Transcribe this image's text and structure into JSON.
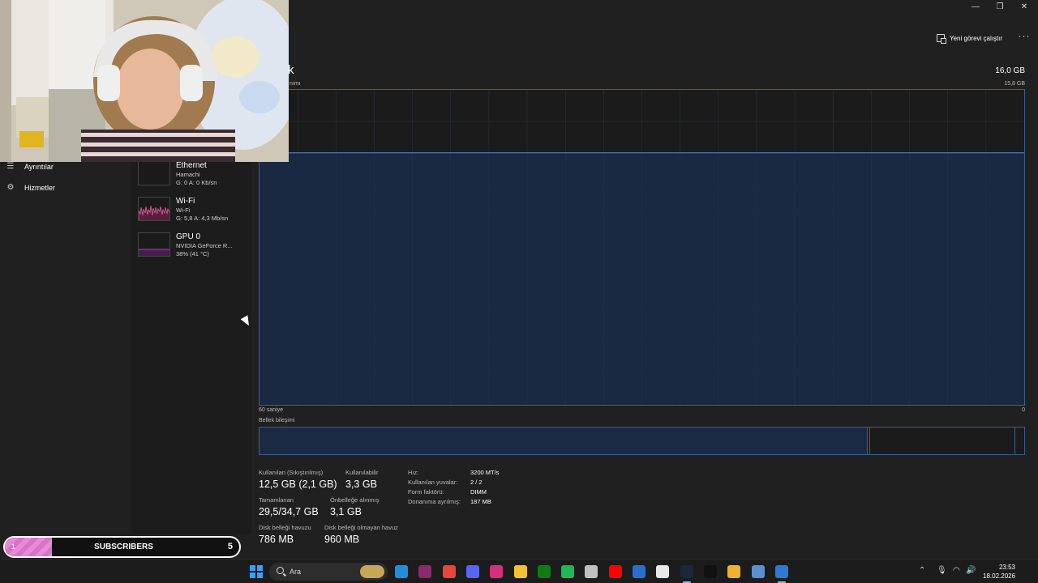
{
  "window": {
    "minimize": "—",
    "maximize": "❐",
    "close": "✕"
  },
  "command_bar": {
    "run_new_task": "Yeni görevi çalıştır",
    "more": "···"
  },
  "nav": {
    "items": [
      {
        "label": "Ayrıntılar",
        "icon": "list-icon"
      },
      {
        "label": "Hizmetler",
        "icon": "puzzle-icon"
      }
    ]
  },
  "devices": [
    {
      "name": "Ethernet",
      "sub": "Hamachi",
      "value": "G: 0 A: 0 Kb/sn",
      "color": "#9c9c9c"
    },
    {
      "name": "Wi-Fi",
      "sub": "Wi-Fi",
      "value": "G: 5,8 A: 4,3 Mb/sn",
      "color": "#e060a0"
    },
    {
      "name": "GPU 0",
      "sub": "NVIDIA GeForce R...",
      "value": "38% (41 °C)",
      "color": "#b040c0"
    }
  ],
  "memory": {
    "title": "k",
    "total": "16,0 GB",
    "usage_label": "nımı",
    "usage_max": "15,8 GB",
    "axis_left": "60 saniye",
    "axis_right": "0",
    "usage_fraction": 0.8,
    "composition_label": "Bellek bileşimi",
    "composition": {
      "in_use_fraction": 0.795,
      "modified_fraction": 0.003,
      "standby_fraction": 0.19
    },
    "stats": {
      "in_use_label": "Kullanılan (Sıkıştırılmış)",
      "in_use_value": "12,5 GB (2,1 GB)",
      "available_label": "Kullanılabilir",
      "available_value": "3,3 GB",
      "committed_label": "Tamamlanan",
      "committed_value": "29,5/34,7 GB",
      "cached_label": "Önbelleğe alınmış",
      "cached_value": "3,1 GB",
      "paged_label": "Disk belleği havuzu",
      "paged_value": "786 MB",
      "nonpaged_label": "Disk belleği olmayan havuz",
      "nonpaged_value": "960 MB"
    },
    "details": [
      {
        "label": "Hız:",
        "value": "3200 MT/s"
      },
      {
        "label": "Kullanılan yuvalar:",
        "value": "2 / 2"
      },
      {
        "label": "Form faktörü:",
        "value": "DIMM"
      },
      {
        "label": "Donanıma ayrılmış:",
        "value": "187 MB"
      }
    ]
  },
  "colors": {
    "memory_line": "#5b8ed6",
    "memory_fill": "#1a2a45",
    "grid": "#2a2f38",
    "accent": "#3b5f8f"
  },
  "subscribers": {
    "current": "1",
    "label": "SUBSCRIBERS",
    "goal": "5",
    "progress_fraction": 0.2
  },
  "taskbar": {
    "search_placeholder": "Ara",
    "apps": [
      "edge-icon",
      "visual-studio-icon",
      "chrome-icon",
      "discord-icon",
      "instagram-icon",
      "file-explorer-icon",
      "xbox-icon",
      "spotify-icon",
      "steam-alt-icon",
      "youtube-icon",
      "mail-icon",
      "notepad-icon",
      "steam-icon",
      "tiktok-icon",
      "app-icon",
      "settings-icon",
      "task-manager-icon"
    ],
    "time": "23:53",
    "date": "18.02.2026"
  }
}
